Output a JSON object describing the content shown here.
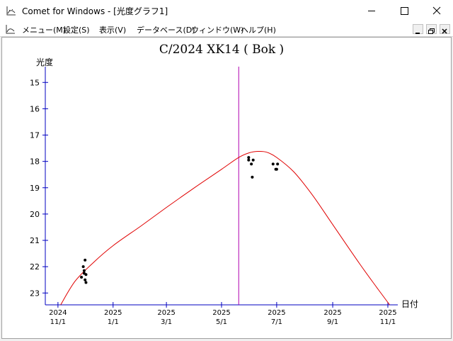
{
  "window": {
    "title": "Comet for Windows - [光度グラフ1]"
  },
  "menu": {
    "items": [
      "メニュー(M)",
      "設定(S)",
      "表示(V)",
      "データベース(D)",
      "ウィンドウ(W)",
      "ヘルプ(H)"
    ]
  },
  "colors": {
    "curve": "#e00000",
    "marker_line": "#b000b0",
    "axis": "#0000c0",
    "points": "#000000"
  },
  "chart_data": {
    "type": "scatter",
    "title": "C/2024 XK14 ( Bok )",
    "ylabel": "光度",
    "xlabel": "日付",
    "y_inverted": true,
    "ylim": [
      14.4,
      23.45
    ],
    "xlim": [
      "2024-10-18",
      "2025-11-12"
    ],
    "yticks": [
      15,
      16,
      17,
      18,
      19,
      20,
      21,
      22,
      23
    ],
    "xticks": [
      {
        "date": "2024-11-01",
        "year": "2024",
        "md": "11/1"
      },
      {
        "date": "2025-01-01",
        "year": "2025",
        "md": "1/1"
      },
      {
        "date": "2025-03-01",
        "year": "2025",
        "md": "3/1"
      },
      {
        "date": "2025-05-01",
        "year": "2025",
        "md": "5/1"
      },
      {
        "date": "2025-07-01",
        "year": "2025",
        "md": "7/1"
      },
      {
        "date": "2025-09-01",
        "year": "2025",
        "md": "9/1"
      },
      {
        "date": "2025-11-01",
        "year": "2025",
        "md": "11/1"
      }
    ],
    "current_date_line": "2025-05-20",
    "predicted_curve": [
      {
        "x": "2024-11-04",
        "y": 23.45
      },
      {
        "x": "2024-11-20",
        "y": 22.55
      },
      {
        "x": "2024-12-10",
        "y": 21.85
      },
      {
        "x": "2025-01-01",
        "y": 21.2
      },
      {
        "x": "2025-02-01",
        "y": 20.45
      },
      {
        "x": "2025-03-01",
        "y": 19.75
      },
      {
        "x": "2025-04-01",
        "y": 19.0
      },
      {
        "x": "2025-05-01",
        "y": 18.3
      },
      {
        "x": "2025-05-20",
        "y": 17.85
      },
      {
        "x": "2025-06-01",
        "y": 17.67
      },
      {
        "x": "2025-06-10",
        "y": 17.62
      },
      {
        "x": "2025-06-20",
        "y": 17.65
      },
      {
        "x": "2025-07-01",
        "y": 17.85
      },
      {
        "x": "2025-07-20",
        "y": 18.4
      },
      {
        "x": "2025-08-10",
        "y": 19.3
      },
      {
        "x": "2025-09-01",
        "y": 20.4
      },
      {
        "x": "2025-10-01",
        "y": 21.9
      },
      {
        "x": "2025-10-20",
        "y": 22.8
      },
      {
        "x": "2025-11-03",
        "y": 23.45
      }
    ],
    "observations": [
      {
        "x": "2024-11-27",
        "y": 22.4
      },
      {
        "x": "2024-11-29",
        "y": 22.0
      },
      {
        "x": "2024-11-30",
        "y": 22.25
      },
      {
        "x": "2024-11-30",
        "y": 22.15
      },
      {
        "x": "2024-12-01",
        "y": 22.5
      },
      {
        "x": "2024-12-01",
        "y": 21.75
      },
      {
        "x": "2024-12-02",
        "y": 22.6
      },
      {
        "x": "2024-12-02",
        "y": 22.3
      },
      {
        "x": "2025-05-31",
        "y": 17.85
      },
      {
        "x": "2025-05-31",
        "y": 17.95
      },
      {
        "x": "2025-06-03",
        "y": 18.1
      },
      {
        "x": "2025-06-04",
        "y": 18.6
      },
      {
        "x": "2025-06-05",
        "y": 17.95
      },
      {
        "x": "2025-06-27",
        "y": 18.1
      },
      {
        "x": "2025-06-30",
        "y": 18.3
      },
      {
        "x": "2025-07-01",
        "y": 18.3
      },
      {
        "x": "2025-07-02",
        "y": 18.1
      }
    ]
  }
}
